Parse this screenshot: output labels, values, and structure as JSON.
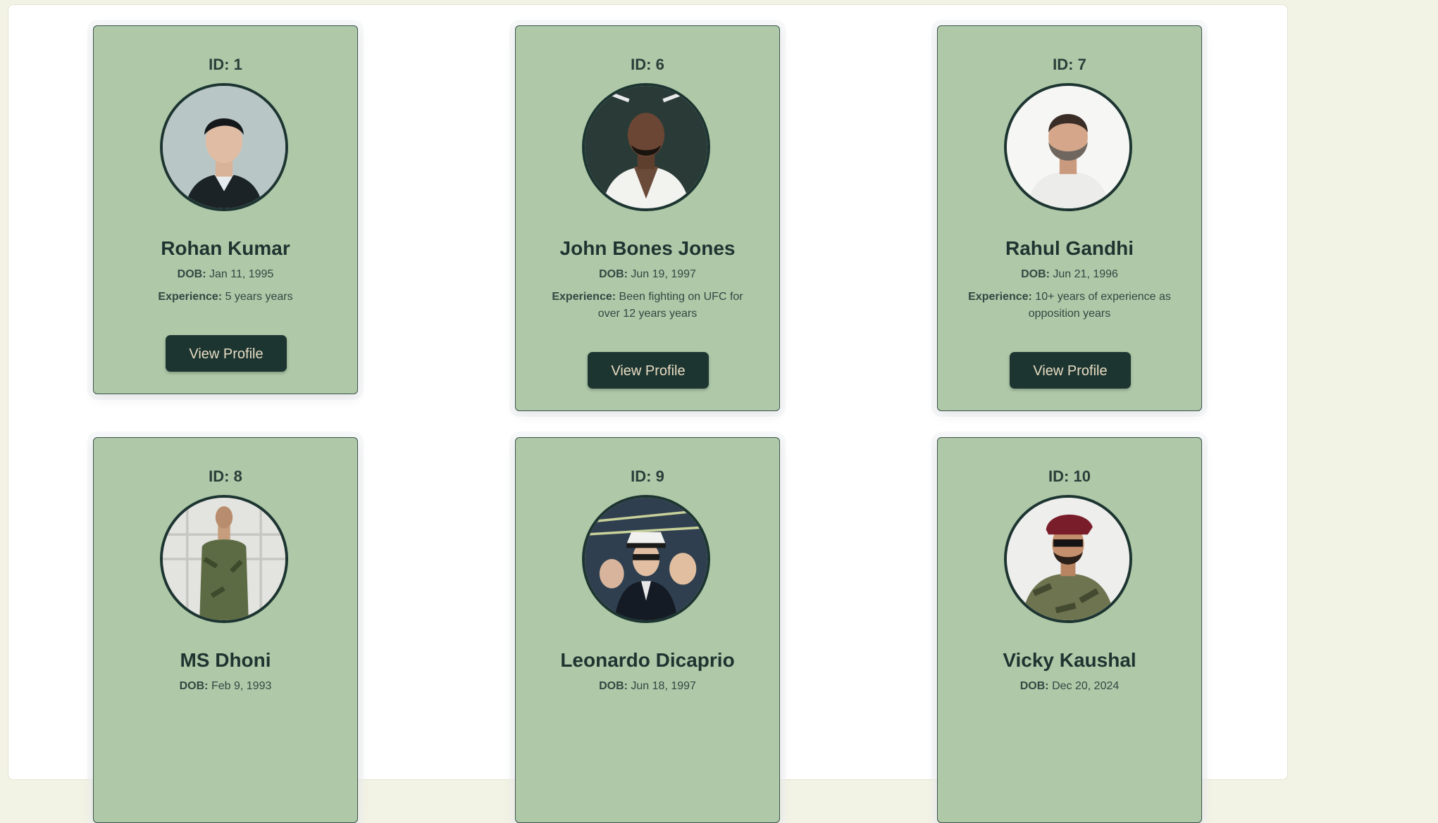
{
  "page": {
    "accent_color": "#aec8a8",
    "dark_color": "#1d3531",
    "background_color": "#f3f3e5"
  },
  "profiles": [
    {
      "id_label": "ID:",
      "id_value": "1",
      "name": "Rohan Kumar",
      "dob_label": "DOB:",
      "dob": "Jan 11, 1995",
      "experience_label": "Experience:",
      "experience": "5 years years",
      "button_label": "View Profile",
      "avatar": "young man in dark suit portrait"
    },
    {
      "id_label": "ID:",
      "id_value": "6",
      "name": "John Bones Jones",
      "dob_label": "DOB:",
      "dob": "Jun 19, 1997",
      "experience_label": "Experience:",
      "experience": "Been fighting on UFC for over 12 years years",
      "button_label": "View Profile",
      "avatar": "man in white shirt with necklace"
    },
    {
      "id_label": "ID:",
      "id_value": "7",
      "name": "Rahul Gandhi",
      "dob_label": "DOB:",
      "dob": "Jun 21, 1996",
      "experience_label": "Experience:",
      "experience": "10+ years of experience as opposition years",
      "button_label": "View Profile",
      "avatar": "bearded man in white kurta"
    },
    {
      "id_label": "ID:",
      "id_value": "8",
      "name": "MS Dhoni",
      "dob_label": "DOB:",
      "dob": "Feb 9, 1993",
      "experience_label": "",
      "experience": "",
      "button_label": "",
      "avatar": "man in army camouflage uniform"
    },
    {
      "id_label": "ID:",
      "id_value": "9",
      "name": "Leonardo Dicaprio",
      "dob_label": "DOB:",
      "dob": "Jun 18, 1997",
      "experience_label": "",
      "experience": "",
      "button_label": "",
      "avatar": "pilot in uniform with crew"
    },
    {
      "id_label": "ID:",
      "id_value": "10",
      "name": "Vicky Kaushal",
      "dob_label": "DOB:",
      "dob": "Dec 20, 2024",
      "experience_label": "",
      "experience": "",
      "button_label": "",
      "avatar": "soldier with maroon beret"
    }
  ]
}
